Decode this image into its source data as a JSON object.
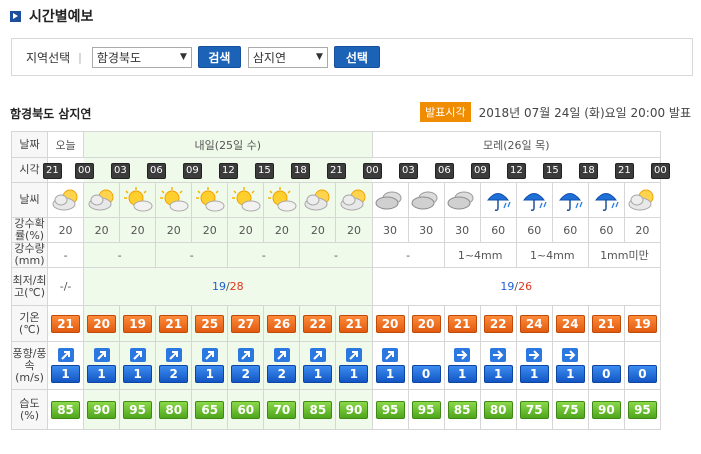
{
  "page_title": "시간별예보",
  "filter": {
    "label": "지역선택",
    "sep": "|",
    "region_value": "함경북도",
    "search_label": "검색",
    "city_value": "삼지연",
    "select_label": "선택"
  },
  "location": "함경북도 삼지연",
  "publish": {
    "badge": "발표시각",
    "time": "2018년 07월 24일 (화)요일 20:00 발표"
  },
  "table": {
    "row_labels": {
      "day": "날짜",
      "time": "시각",
      "sky": "날씨",
      "pop": "강수확률(%)",
      "pcp": "강수량(mm)",
      "minmax": "최저/최고(℃)",
      "temp": "기온(℃)",
      "wind": "풍향/풍속(m/s)",
      "humidity": "습도(%)"
    },
    "days": [
      {
        "label": "오늘",
        "span": 1
      },
      {
        "label": "내일(25일 수)",
        "span": 8
      },
      {
        "label": "모레(26일 목)",
        "span": 8
      }
    ],
    "times": [
      "21",
      "00",
      "03",
      "06",
      "09",
      "12",
      "15",
      "18",
      "21",
      "00",
      "03",
      "06",
      "09",
      "12",
      "15",
      "18",
      "21",
      "00"
    ],
    "sky": [
      "partly-cloudy-icon",
      "partly-cloudy-icon",
      "sunny-cloud-icon",
      "sunny-cloud-icon",
      "sunny-cloud-icon",
      "sunny-cloud-icon",
      "sunny-cloud-icon",
      "partly-cloudy-icon",
      "partly-cloudy-icon",
      "cloudy-icon",
      "cloudy-icon",
      "cloudy-icon",
      "rain-icon",
      "rain-icon",
      "rain-icon",
      "rain-icon",
      "partly-cloudy-icon"
    ],
    "pop": [
      "20",
      "20",
      "20",
      "20",
      "20",
      "20",
      "20",
      "20",
      "20",
      "30",
      "30",
      "30",
      "60",
      "60",
      "60",
      "60",
      "20"
    ],
    "pcp": [
      {
        "v": "-",
        "span": 1
      },
      {
        "v": "-",
        "span": 2
      },
      {
        "v": "-",
        "span": 2
      },
      {
        "v": "-",
        "span": 2
      },
      {
        "v": "-",
        "span": 2
      },
      {
        "v": "-",
        "span": 2
      },
      {
        "v": "1~4mm",
        "span": 2
      },
      {
        "v": "1~4mm",
        "span": 2
      },
      {
        "v": "1mm미만",
        "span": 2
      }
    ],
    "minmax": [
      {
        "min": "-",
        "sep": "/",
        "max": "-",
        "span": 1
      },
      {
        "min": "19",
        "sep": "/",
        "max": "28",
        "span": 8
      },
      {
        "min": "19",
        "sep": "/",
        "max": "26",
        "span": 8
      }
    ],
    "temp": [
      "21",
      "20",
      "19",
      "21",
      "25",
      "27",
      "26",
      "22",
      "21",
      "20",
      "20",
      "21",
      "22",
      "24",
      "24",
      "21",
      "19"
    ],
    "wind_dir": [
      "ne",
      "ne",
      "ne",
      "ne",
      "ne",
      "ne",
      "ne",
      "ne",
      "ne",
      "ne",
      "",
      "e",
      "e",
      "e",
      "e",
      "",
      ""
    ],
    "wind_speed": [
      "1",
      "1",
      "1",
      "2",
      "1",
      "2",
      "2",
      "1",
      "1",
      "1",
      "0",
      "1",
      "1",
      "1",
      "1",
      "0",
      "0"
    ],
    "humidity": [
      "85",
      "90",
      "95",
      "80",
      "65",
      "60",
      "70",
      "85",
      "90",
      "95",
      "95",
      "85",
      "80",
      "75",
      "75",
      "90",
      "95"
    ]
  },
  "colors": {
    "accent": "#1c63b7",
    "badge": "#f08c00",
    "temp": "#f07020",
    "humidity": "#5bb523",
    "wind": "#1c62d0"
  }
}
